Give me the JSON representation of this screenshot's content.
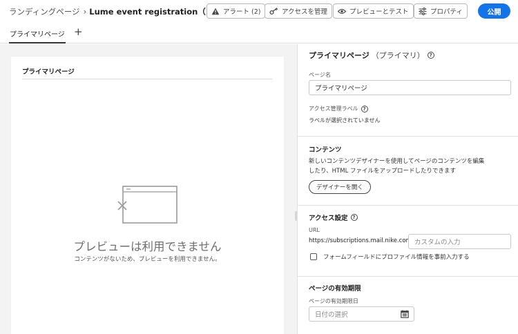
{
  "header": {
    "breadcrumb_root": "ランディングページ",
    "breadcrumb_sep": "›",
    "title": "Lume event registration（ドラフト）",
    "alerts_label": "アラート (2)",
    "access_label": "アクセスを管理",
    "preview_label": "プレビューとテスト",
    "properties_label": "プロパティ",
    "publish_label": "公開"
  },
  "tabs": {
    "items": [
      {
        "label": "プライマリページ"
      }
    ],
    "add_symbol": "+"
  },
  "preview": {
    "card_title": "プライマリページ",
    "empty_title": "プレビューは利用できません",
    "empty_subtitle": "コンテンツがないため、プレビューを利用できません。"
  },
  "panel": {
    "title": "プライマリページ",
    "title_sub": "（プライマリ）",
    "page_name_label": "ページ名",
    "page_name_value": "プライマリページ",
    "access_label": "アクセス管理ラベル",
    "access_note": "ラベルが選択されていません",
    "content": {
      "heading": "コンテンツ",
      "desc_line1": "新しいコンテンツデザイナーを使用してページのコンテンツを編集",
      "desc_line2": "したり、HTML ファイルをアップロードしたりできます",
      "designer_button": "デザイナーを開く"
    },
    "access_settings": {
      "heading": "アクセス設定",
      "url_label": "URL",
      "url_prefix": "https://subscriptions.mail.nike.com/lp/",
      "custom_placeholder": "カスタムの入力",
      "prefill_label": "フォームフィールドにプロファイル情報を事前入力する"
    },
    "expiry": {
      "heading": "ページの有効期限",
      "date_label": "ページの有効期限日",
      "date_placeholder": "日付の選択"
    }
  },
  "colors": {
    "accent": "#1473e6",
    "canvas_bg": "#f3f3f3"
  }
}
